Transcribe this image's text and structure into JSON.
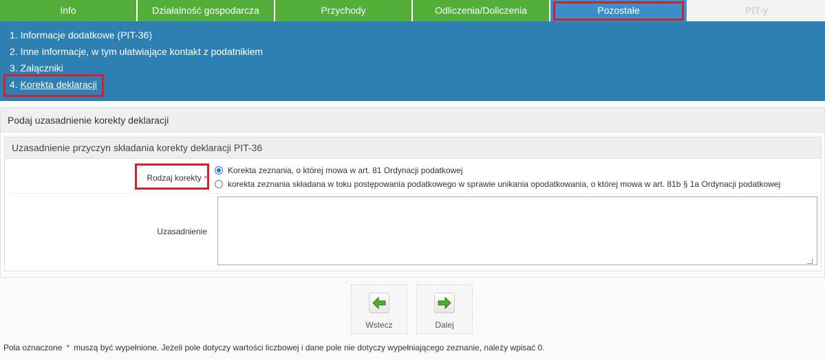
{
  "tabs": [
    {
      "label": "Info",
      "state": "normal"
    },
    {
      "label": "Działalność gospodarcza",
      "state": "normal"
    },
    {
      "label": "Przychody",
      "state": "normal"
    },
    {
      "label": "Odliczenia/Doliczenia",
      "state": "normal"
    },
    {
      "label": "Pozostałe",
      "state": "active"
    },
    {
      "label": "PIT-y",
      "state": "disabled"
    }
  ],
  "subnav": {
    "items": [
      {
        "number": "1.",
        "label": "Informacje dodatkowe (PIT-36)"
      },
      {
        "number": "2.",
        "label": "Inne informacje, w tym ułatwiające kontakt z podatnikiem"
      },
      {
        "number": "3.",
        "label": "Załączniki"
      },
      {
        "number": "4.",
        "label": "Korekta deklaracji",
        "active": true
      }
    ]
  },
  "section": {
    "title": "Podaj uzasadnienie korekty deklaracji",
    "panel_title": "Uzasadnienie przyczyn składania korekty deklaracji PIT-36",
    "correction_type": {
      "label": "Rodzaj korekty",
      "required_mark": "*",
      "options": [
        {
          "label": "Korekta zeznania, o której mowa w art. 81 Ordynacji podatkowej",
          "checked": true
        },
        {
          "label": "korekta zeznania składana w toku postępowania podatkowego w sprawie unikania opodatkowania, o której mowa w art. 81b § 1a Ordynacji podatkowej",
          "checked": false
        }
      ]
    },
    "justification": {
      "label": "Uzasadnienie",
      "value": ""
    }
  },
  "buttons": {
    "back_label": "Wstecz",
    "next_label": "Dalej"
  },
  "footer": {
    "prefix": "Pola oznaczone",
    "star": "*",
    "suffix": "muszą być wypełnione. Jeżeli pole dotyczy wartości liczbowej i dane pole nie dotyczy wypełniającego zeznanie, należy wpisać 0."
  },
  "colors": {
    "tab_green": "#54ae3a",
    "tab_active": "#3a8fc8",
    "subnav_blue": "#2e80b2",
    "highlight_red": "#d4202b",
    "arrow_green": "#4caf2a"
  }
}
